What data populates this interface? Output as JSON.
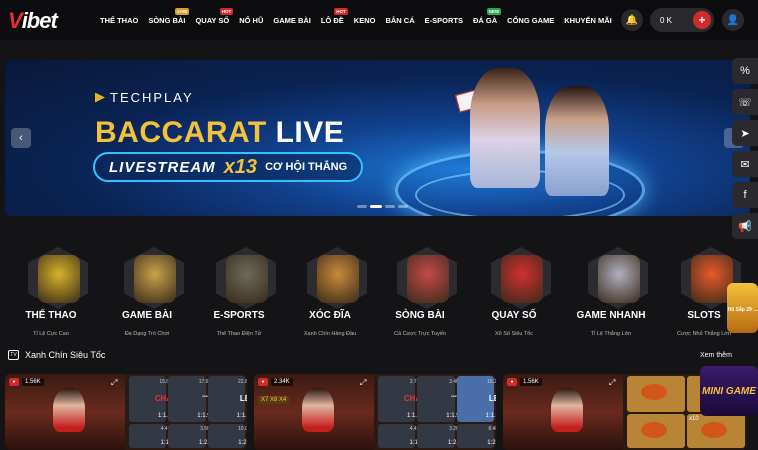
{
  "header": {
    "logo_v": "V",
    "logo_rest": "ibet",
    "nav": [
      {
        "label": "THỂ THAO",
        "tag": ""
      },
      {
        "label": "SÒNG BÀI",
        "tag": "LIVE"
      },
      {
        "label": "QUAY SỐ",
        "tag": "HOT"
      },
      {
        "label": "NỔ HŨ",
        "tag": ""
      },
      {
        "label": "GAME BÀI",
        "tag": ""
      },
      {
        "label": "LÔ ĐỀ",
        "tag": "HOT"
      },
      {
        "label": "KENO",
        "tag": ""
      },
      {
        "label": "BẮN CÁ",
        "tag": ""
      },
      {
        "label": "E-SPORTS",
        "tag": ""
      },
      {
        "label": "ĐÁ GÀ",
        "tag": "NEW"
      },
      {
        "label": "CỔNG GAME",
        "tag": ""
      },
      {
        "label": "KHUYẾN MÃI",
        "tag": ""
      }
    ],
    "balance": "0 K",
    "plus": "+"
  },
  "banner": {
    "brand": "TECHPLAY",
    "headline_a": "BACCARAT",
    "headline_b": "LIVE",
    "live_word": "LIVESTREAM",
    "multiplier": "x13",
    "tagline": "CƠ HỘI THẮNG",
    "prev": "‹",
    "next": "›"
  },
  "categories": [
    {
      "title": "THỂ THAO",
      "sub": "Tỉ Lệ Cực Cao",
      "color": "#d8b22a"
    },
    {
      "title": "GAME BÀI",
      "sub": "Đa Dạng Trò Chơi",
      "color": "#c9a24a"
    },
    {
      "title": "E-SPORTS",
      "sub": "Thể Thao Điện Tử",
      "color": "#6b6b5a"
    },
    {
      "title": "XÓC ĐĨA",
      "sub": "Xanh Chín Hàng Đầu",
      "color": "#c98b3a"
    },
    {
      "title": "SÒNG BÀI",
      "sub": "Cá Cược Trực Tuyến",
      "color": "#c44a4a"
    },
    {
      "title": "QUAY SỐ",
      "sub": "Xổ Số Siêu Tốc",
      "color": "#d03030"
    },
    {
      "title": "GAME NHANH",
      "sub": "Tỉ Lệ Thắng Lớn",
      "color": "#b0b0c0"
    },
    {
      "title": "SLOTS",
      "sub": "Cược Nhỏ Thắng Lớn",
      "color": "#e85a2a"
    }
  ],
  "promo": {
    "label": "Hũ Sắp 29 ..."
  },
  "section": {
    "title": "Xanh Chín Siêu Tốc",
    "see_more": "Xem thêm",
    "icon": "TV"
  },
  "games": [
    {
      "viewers": "1.56K",
      "bets": [
        {
          "pct": "15.8M",
          "label": "CHẴN",
          "odds": "1:1.96",
          "kind": "red"
        },
        {
          "pct": "17.6M",
          "label": "••••",
          "odds": "1:1.95",
          "kind": "pips"
        },
        {
          "pct": "22.8M",
          "label": "LẺ",
          "odds": "1:1.96",
          "kind": ""
        },
        {
          "pct": "4.4M",
          "label": "",
          "odds": "1:12",
          "kind": "small"
        },
        {
          "pct": "3.5M",
          "label": "",
          "odds": "1:2.6",
          "kind": "small"
        },
        {
          "pct": "10.0M",
          "label": "",
          "odds": "1:2.6",
          "kind": "small"
        }
      ]
    },
    {
      "viewers": "2.34K",
      "banner": "X7 X8 X4",
      "bets": [
        {
          "pct": "3.7M",
          "label": "CHẴN",
          "odds": "1:1.95",
          "kind": "red"
        },
        {
          "pct": "3.4M",
          "label": "••••",
          "odds": "1:1.95",
          "kind": "pips"
        },
        {
          "pct": "15.2M",
          "label": "LẺ",
          "odds": "1:1.95",
          "kind": "blue"
        },
        {
          "pct": "4.4M",
          "label": "",
          "odds": "1:12",
          "kind": "small"
        },
        {
          "pct": "3.2M",
          "label": "",
          "odds": "1:2.6",
          "kind": "small"
        },
        {
          "pct": "8.4M",
          "label": "",
          "odds": "1:2.6",
          "kind": "small"
        }
      ]
    },
    {
      "viewers": "1.56K",
      "fish": [
        {
          "x": ""
        },
        {
          "x": ""
        },
        {
          "x": ""
        },
        {
          "x": "x10"
        }
      ]
    }
  ],
  "mini_game": "MINI GAME"
}
